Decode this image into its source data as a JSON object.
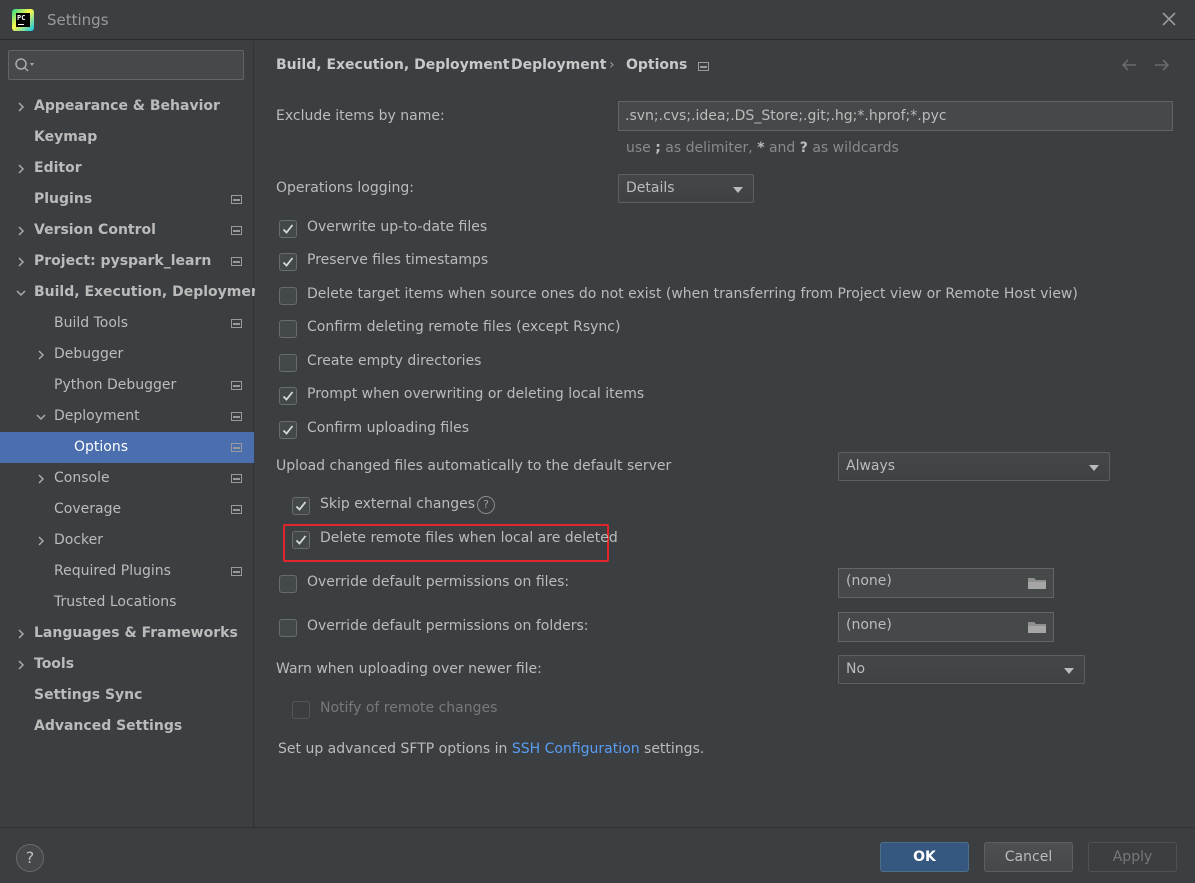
{
  "window": {
    "title": "Settings",
    "logo_text": "PC"
  },
  "sidebar": {
    "search_placeholder": "",
    "items": [
      {
        "label": "Appearance & Behavior"
      },
      {
        "label": "Keymap"
      },
      {
        "label": "Editor"
      },
      {
        "label": "Plugins"
      },
      {
        "label": "Version Control"
      },
      {
        "label": "Project: pyspark_learn"
      },
      {
        "label": "Build, Execution, Deployment"
      },
      {
        "label": "Build Tools"
      },
      {
        "label": "Debugger"
      },
      {
        "label": "Python Debugger"
      },
      {
        "label": "Deployment"
      },
      {
        "label": "Options"
      },
      {
        "label": "Console"
      },
      {
        "label": "Coverage"
      },
      {
        "label": "Docker"
      },
      {
        "label": "Required Plugins"
      },
      {
        "label": "Trusted Locations"
      },
      {
        "label": "Languages & Frameworks"
      },
      {
        "label": "Tools"
      },
      {
        "label": "Settings Sync"
      },
      {
        "label": "Advanced Settings"
      }
    ]
  },
  "breadcrumb": {
    "part1": "Build, Execution, Deployment",
    "part2": "Deployment",
    "part3": "Options",
    "sep": "›"
  },
  "form": {
    "exclude_label": "Exclude items by name:",
    "exclude_value": ".svn;.cvs;.idea;.DS_Store;.git;.hg;*.hprof;*.pyc",
    "hint_pre": "use ",
    "hint_semicolon": ";",
    "hint_mid1": " as delimiter, ",
    "hint_star": "*",
    "hint_mid2": " and ",
    "hint_q": "?",
    "hint_post": " as wildcards",
    "logging_label": "Operations logging:",
    "logging_value": "Details",
    "checkboxes": [
      {
        "label": "Overwrite up-to-date files",
        "checked": true
      },
      {
        "label": "Preserve files timestamps",
        "checked": true
      },
      {
        "label": "Delete target items when source ones do not exist (when transferring from Project view or Remote Host view)",
        "checked": false
      },
      {
        "label": "Confirm deleting remote files (except Rsync)",
        "checked": false
      },
      {
        "label": "Create empty directories",
        "checked": false
      },
      {
        "label": "Prompt when overwriting or deleting local items",
        "checked": true
      },
      {
        "label": "Confirm uploading files",
        "checked": true
      }
    ],
    "upload_label": "Upload changed files automatically to the default server",
    "upload_value": "Always",
    "skip_external_label": "Skip external changes",
    "delete_remote_label": "Delete remote files when local are deleted",
    "override_files_label": "Override default permissions on files:",
    "override_files_value": "(none)",
    "override_folders_label": "Override default permissions on folders:",
    "override_folders_value": "(none)",
    "warn_label": "Warn when uploading over newer file:",
    "warn_value": "No",
    "notify_label": "Notify of remote changes",
    "footer_pre": "Set up advanced SFTP options in ",
    "footer_link": "SSH Configuration",
    "footer_post": " settings."
  },
  "buttons": {
    "help": "?",
    "ok": "OK",
    "cancel": "Cancel",
    "apply": "Apply"
  }
}
